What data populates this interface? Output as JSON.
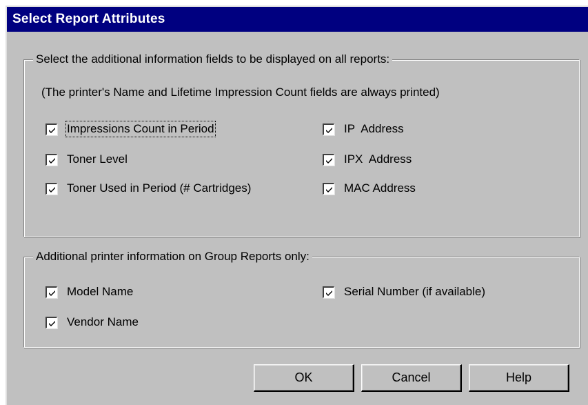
{
  "dialog": {
    "title": "Select Report Attributes"
  },
  "group_fields": {
    "legend": "Select the additional information fields to be displayed on all reports:",
    "note": "(The printer's Name and Lifetime Impression Count fields are always printed)",
    "checkboxes": [
      {
        "label": "Impressions Count in Period",
        "mnemonic": "C",
        "checked": true,
        "focused": true
      },
      {
        "label": "Toner Level",
        "mnemonic": "T",
        "checked": true
      },
      {
        "label": "Toner Used in Period (# Cartridges)",
        "mnemonic": "U",
        "checked": true
      },
      {
        "label": "IP  Address",
        "mnemonic": "I",
        "checked": true
      },
      {
        "label": "IPX  Address",
        "mnemonic": "X",
        "checked": true
      },
      {
        "label": "MAC Address",
        "mnemonic": "M",
        "checked": true
      }
    ]
  },
  "group_additional": {
    "legend": "Additional printer information on Group Reports only:",
    "checkboxes": [
      {
        "label": "Model Name",
        "mnemonic": "d",
        "checked": true
      },
      {
        "label": "Vendor Name",
        "mnemonic": "V",
        "checked": true
      },
      {
        "label": "Serial Number (if available)",
        "mnemonic": "S",
        "checked": true
      }
    ]
  },
  "buttons": {
    "ok": "OK",
    "cancel": "Cancel",
    "help": "Help"
  }
}
